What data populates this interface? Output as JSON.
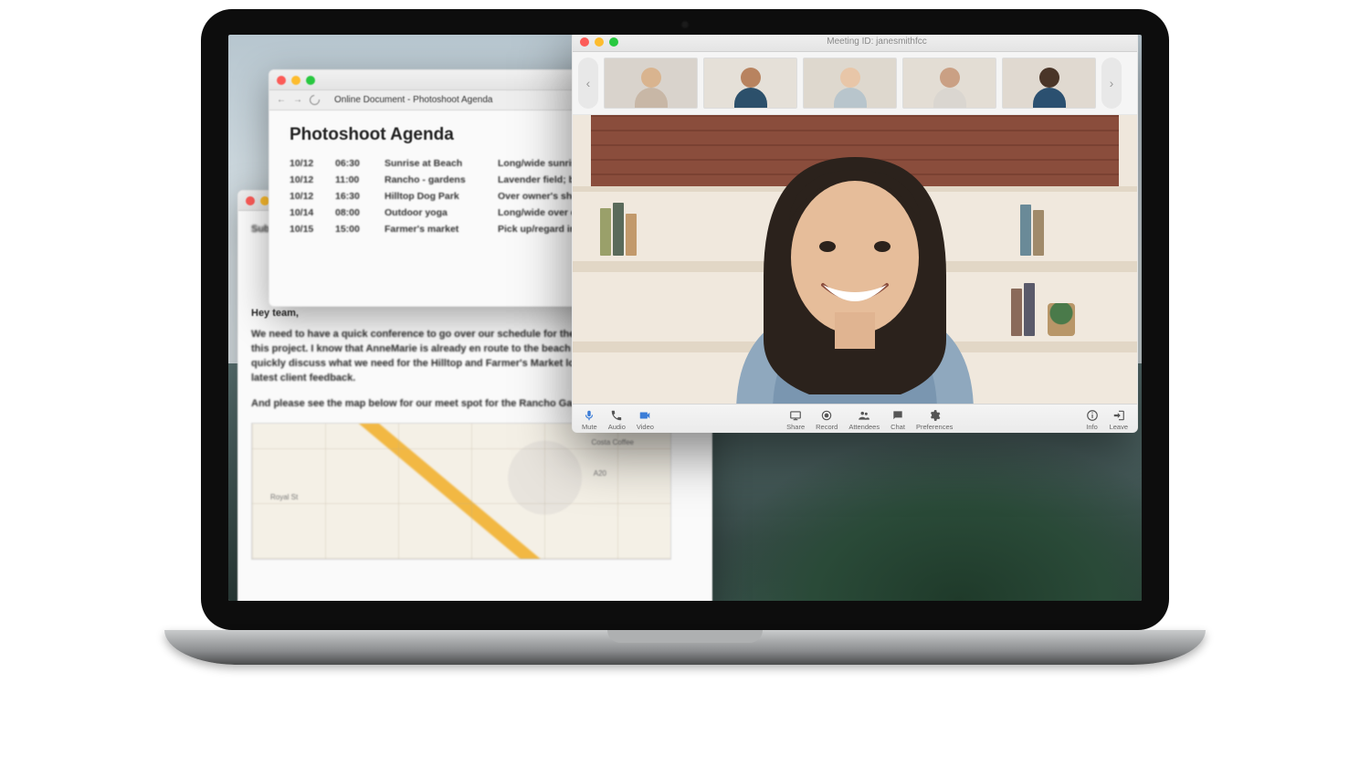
{
  "document": {
    "tab_title": "Online Document - Photoshoot Agenda",
    "heading": "Photoshoot Agenda",
    "rows": [
      {
        "date": "10/12",
        "time": "06:30",
        "location": "Sunrise at Beach",
        "notes": "Long/wide sunrise;"
      },
      {
        "date": "10/12",
        "time": "11:00",
        "location": "Rancho - gardens",
        "notes": "Lavender field; banyan"
      },
      {
        "date": "10/12",
        "time": "16:30",
        "location": "Hilltop Dog Park",
        "notes": "Over owner's shoulders"
      },
      {
        "date": "10/14",
        "time": "08:00",
        "location": "Outdoor yoga",
        "notes": "Long/wide over crowd"
      },
      {
        "date": "10/15",
        "time": "15:00",
        "location": "Farmer's market",
        "notes": "Pick up/regard imperfec"
      }
    ]
  },
  "email": {
    "subject_label": "Sub",
    "greeting": "Hey team,",
    "para1": "We need to have a quick conference to go over our schedule for the second \nthis project. I know that AnneMarie is already en route to the beach shoot, I \nquickly discuss what we need for the Hilltop and Farmer's Market locations g \nlatest client feedback.",
    "para2": "And please see the map below for our meet spot for the Rancho Gardens:",
    "map_labels": {
      "l1": "Costa Coffee",
      "l2": "Royal St",
      "l3": "A20"
    }
  },
  "meeting": {
    "title": "Meeting ID: janesmithfcc",
    "toolbar_left": [
      {
        "key": "mute",
        "label": "Mute",
        "icon": "mic"
      },
      {
        "key": "audio",
        "label": "Audio",
        "icon": "phone"
      },
      {
        "key": "video",
        "label": "Video",
        "icon": "camera"
      }
    ],
    "toolbar_center": [
      {
        "key": "share",
        "label": "Share",
        "icon": "share"
      },
      {
        "key": "record",
        "label": "Record",
        "icon": "record"
      },
      {
        "key": "attendees",
        "label": "Attendees",
        "icon": "people"
      },
      {
        "key": "chat",
        "label": "Chat",
        "icon": "chat"
      },
      {
        "key": "preferences",
        "label": "Preferences",
        "icon": "gear"
      }
    ],
    "toolbar_right": [
      {
        "key": "info",
        "label": "Info",
        "icon": "info"
      },
      {
        "key": "leave",
        "label": "Leave",
        "icon": "leave"
      }
    ]
  }
}
